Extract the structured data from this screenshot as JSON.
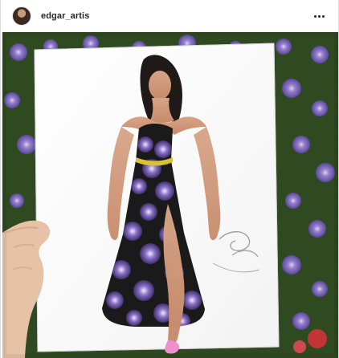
{
  "post": {
    "username": "edgar_artis",
    "avatar_icon": "profile-avatar",
    "more_icon": "more-options-icon",
    "image": {
      "subject_icons": [
        "flower-background",
        "paper-sketch",
        "hand",
        "signature"
      ]
    }
  },
  "colors": {
    "flowers": "#8a71c6",
    "foliage": "#2f4a21",
    "sash": "#d8c233",
    "shoe": "#f08fd0"
  }
}
